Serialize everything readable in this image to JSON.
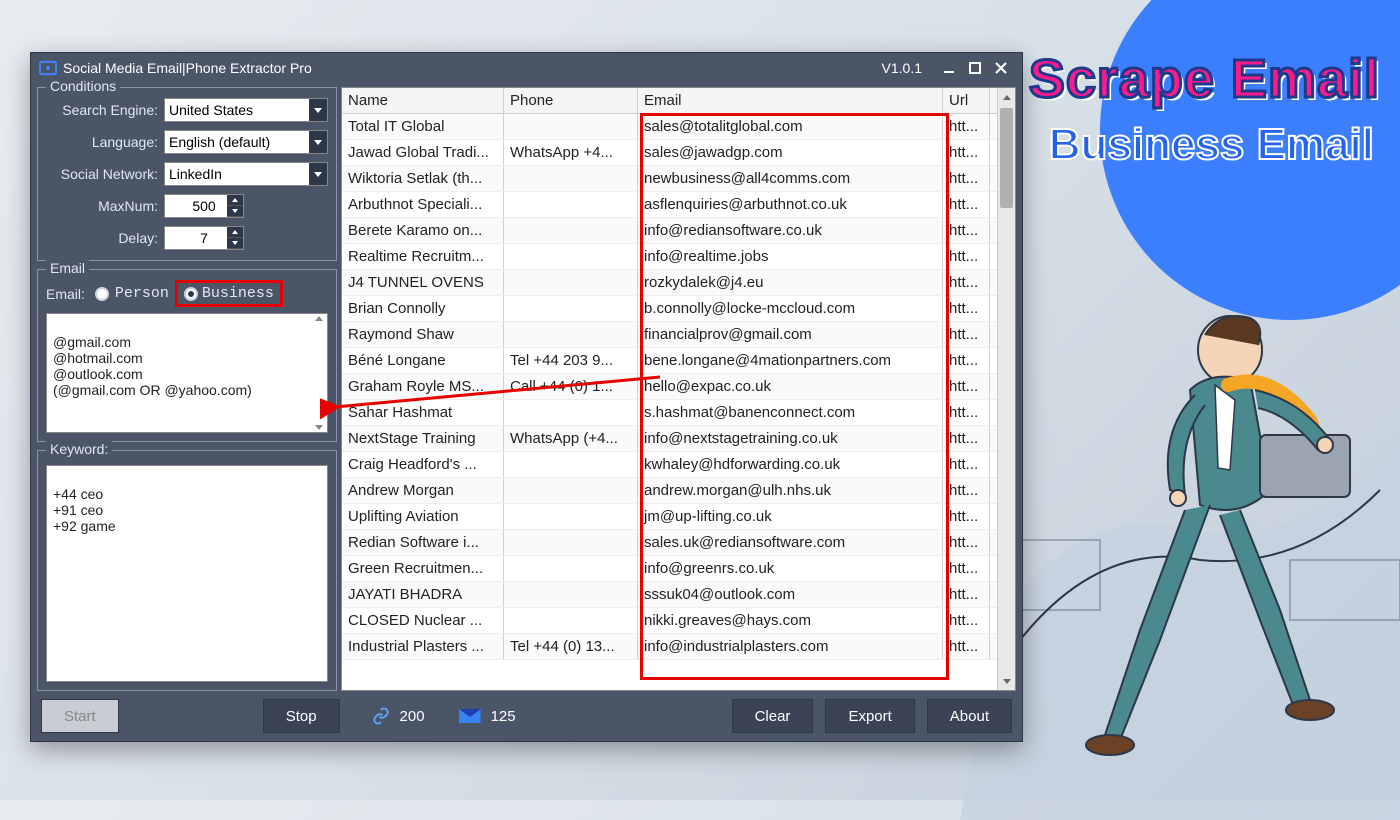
{
  "overlay": {
    "title": "Scrape Email",
    "subtitle": "Business Email"
  },
  "app": {
    "title": "Social Media Email|Phone Extractor Pro",
    "version": "V1.0.1"
  },
  "conditions": {
    "legend": "Conditions",
    "search_engine_label": "Search Engine:",
    "search_engine_value": "United States",
    "language_label": "Language:",
    "language_value": "English (default)",
    "social_label": "Social Network:",
    "social_value": "LinkedIn",
    "maxnum_label": "MaxNum:",
    "maxnum_value": "500",
    "delay_label": "Delay:",
    "delay_value": "7"
  },
  "email_group": {
    "legend": "Email",
    "field_label": "Email:",
    "person_label": "Person",
    "business_label": "Business",
    "selected": "Business",
    "domains_text": "@gmail.com\n@hotmail.com\n@outlook.com\n(@gmail.com OR @yahoo.com)"
  },
  "keyword_group": {
    "legend": "Keyword:",
    "text": "+44 ceo\n+91 ceo\n+92 game"
  },
  "table": {
    "headers": {
      "name": "Name",
      "phone": "Phone",
      "email": "Email",
      "url": "Url"
    },
    "rows": [
      {
        "name": "Total IT Global",
        "phone": "",
        "email": "sales@totalitglobal.com",
        "url": "htt..."
      },
      {
        "name": "Jawad Global Tradi...",
        "phone": "WhatsApp  +4...",
        "email": "sales@jawadgp.com",
        "url": "htt..."
      },
      {
        "name": "Wiktoria Setlak (th...",
        "phone": "",
        "email": "newbusiness@all4comms.com",
        "url": "htt..."
      },
      {
        "name": "Arbuthnot Speciali...",
        "phone": "",
        "email": "asflenquiries@arbuthnot.co.uk",
        "url": "htt..."
      },
      {
        "name": "Berete Karamo on...",
        "phone": "",
        "email": "info@rediansoftware.co.uk",
        "url": "htt..."
      },
      {
        "name": "Realtime Recruitm...",
        "phone": "",
        "email": "info@realtime.jobs",
        "url": "htt..."
      },
      {
        "name": "J4 TUNNEL OVENS",
        "phone": "",
        "email": "rozkydalek@j4.eu",
        "url": "htt..."
      },
      {
        "name": "Brian Connolly",
        "phone": "",
        "email": "b.connolly@locke-mccloud.com",
        "url": "htt..."
      },
      {
        "name": "Raymond Shaw",
        "phone": "",
        "email": "financialprov@gmail.com",
        "url": "htt..."
      },
      {
        "name": "Béné Longane",
        "phone": "Tel +44 203 9...",
        "email": "bene.longane@4mationpartners.com",
        "url": "htt..."
      },
      {
        "name": "Graham Royle MS...",
        "phone": "Call +44 (0) 1...",
        "email": "hello@expac.co.uk",
        "url": "htt..."
      },
      {
        "name": "Sahar Hashmat",
        "phone": "",
        "email": "s.hashmat@banenconnect.com",
        "url": "htt..."
      },
      {
        "name": "NextStage Training",
        "phone": "WhatsApp (+4...",
        "email": "info@nextstagetraining.co.uk",
        "url": "htt..."
      },
      {
        "name": "Craig Headford's ...",
        "phone": "",
        "email": "kwhaley@hdforwarding.co.uk",
        "url": "htt..."
      },
      {
        "name": "Andrew Morgan",
        "phone": "",
        "email": "andrew.morgan@ulh.nhs.uk",
        "url": "htt..."
      },
      {
        "name": "Uplifting Aviation",
        "phone": "",
        "email": "jm@up-lifting.co.uk",
        "url": "htt..."
      },
      {
        "name": "Redian Software i...",
        "phone": "",
        "email": "sales.uk@rediansoftware.com",
        "url": "htt..."
      },
      {
        "name": "Green Recruitmen...",
        "phone": "",
        "email": "info@greenrs.co.uk",
        "url": "htt..."
      },
      {
        "name": "JAYATI BHADRA",
        "phone": "",
        "email": "sssuk04@outlook.com",
        "url": "htt..."
      },
      {
        "name": "CLOSED Nuclear ...",
        "phone": "",
        "email": "nikki.greaves@hays.com",
        "url": "htt..."
      },
      {
        "name": "Industrial Plasters ...",
        "phone": "Tel +44 (0) 13...",
        "email": "info@industrialplasters.com",
        "url": "htt..."
      }
    ]
  },
  "buttons": {
    "start": "Start",
    "stop": "Stop",
    "clear": "Clear",
    "export": "Export",
    "about": "About"
  },
  "status": {
    "links": "200",
    "emails": "125"
  }
}
